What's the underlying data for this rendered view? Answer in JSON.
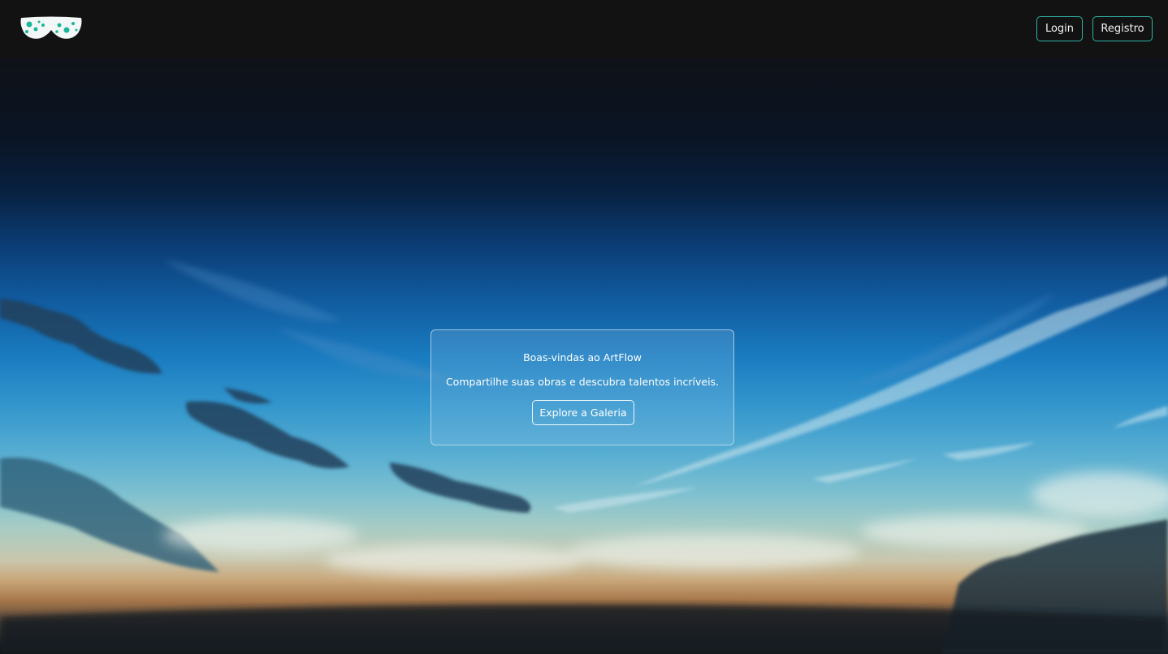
{
  "header": {
    "logo_icon": "glasses-logo-icon",
    "login_label": "Login",
    "register_label": "Registro"
  },
  "hero": {
    "title": "Boas-vindas ao ArtFlow",
    "subtitle": "Compartilhe suas obras e descubra talentos incríveis.",
    "cta_label": "Explore a Galeria"
  },
  "colors": {
    "header_bg": "#121212",
    "accent_border": "#2fb3a2",
    "logo_spots": "#17b79b"
  }
}
